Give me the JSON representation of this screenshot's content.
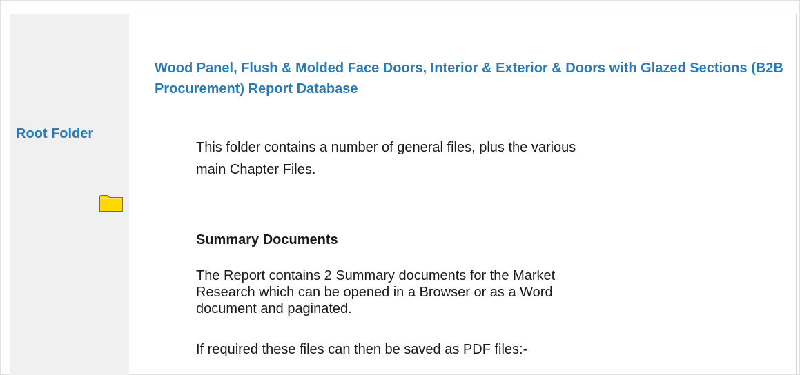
{
  "sidebar": {
    "title": "Root Folder",
    "icon": "folder-icon"
  },
  "main": {
    "report_title": "Wood Panel, Flush & Molded Face Doors, Interior & Exterior & Doors with Glazed Sections (B2B Procurement) Report Database",
    "intro": "This folder contains a number of general files, plus the various main Chapter Files.",
    "section_heading": "Summary Documents",
    "summary_text": "The Report contains 2 Summary documents for the Market Research which can be opened in a Browser or as a Word document and paginated.",
    "pdf_text": "If required these files can then be saved as PDF files:-"
  },
  "colors": {
    "accent": "#2a7ab8",
    "sidebar_bg": "#f0f0f0",
    "folder_fill": "#ffd800",
    "folder_stroke": "#8a6d00"
  }
}
